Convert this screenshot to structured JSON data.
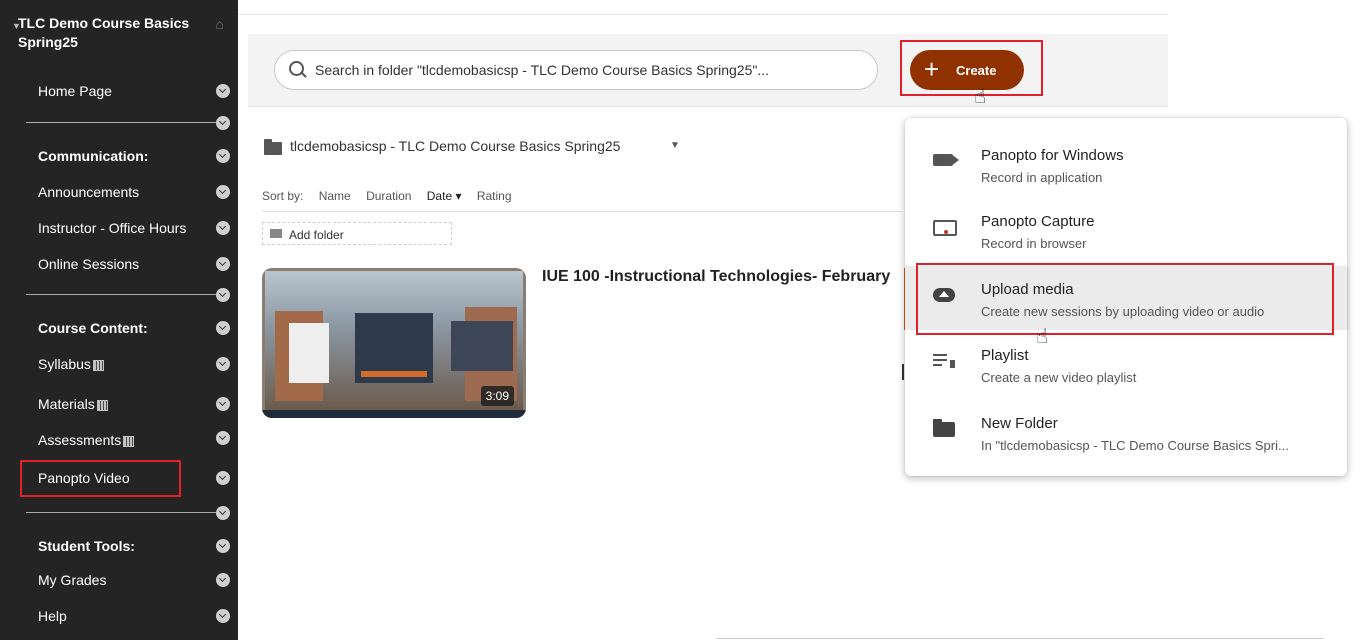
{
  "sidebar": {
    "course_title": "TLC Demo Course Basics Spring25",
    "items": {
      "home_page": "Home Page",
      "communication": "Communication:",
      "announcements": "Announcements",
      "office_hours": "Instructor - Office Hours",
      "online_sessions": "Online Sessions",
      "course_content": "Course Content:",
      "syllabus": "Syllabus",
      "materials": "Materials",
      "assessments": "Assessments",
      "panopto_video": "Panopto Video",
      "student_tools": "Student Tools:",
      "my_grades": "My Grades",
      "help": "Help"
    }
  },
  "search": {
    "placeholder": "Search in folder \"tlcdemobasicsp - TLC Demo Course Basics Spring25\"..."
  },
  "create_button": {
    "label": "Create"
  },
  "folder": {
    "name": "tlcdemobasicsp - TLC Demo Course Basics Spring25"
  },
  "sort": {
    "label": "Sort by:",
    "options": [
      "Name",
      "Duration",
      "Date ▾",
      "Rating"
    ]
  },
  "add_folder": "Add folder",
  "video": {
    "title": "IUE 100 -Instructional Technologies- February",
    "duration": "3:09"
  },
  "create_menu": {
    "items": [
      {
        "title": "Panopto for Windows",
        "subtitle": "Record in application",
        "icon": "video-camera-icon"
      },
      {
        "title": "Panopto Capture",
        "subtitle": "Record in browser",
        "icon": "screen-record-icon"
      },
      {
        "title": "Upload media",
        "subtitle": "Create new sessions by uploading video or audio",
        "icon": "cloud-upload-icon"
      },
      {
        "title": "Playlist",
        "subtitle": "Create a new video playlist",
        "icon": "playlist-icon"
      },
      {
        "title": "New Folder",
        "subtitle": "In \"tlcdemobasicsp - TLC Demo Course Basics Spri...",
        "icon": "folder-icon"
      }
    ]
  },
  "colors": {
    "sidebar_bg": "#242424",
    "create_button": "#8f3200",
    "highlight_box": "#e0202a",
    "accent_orange": "#d75a16"
  }
}
